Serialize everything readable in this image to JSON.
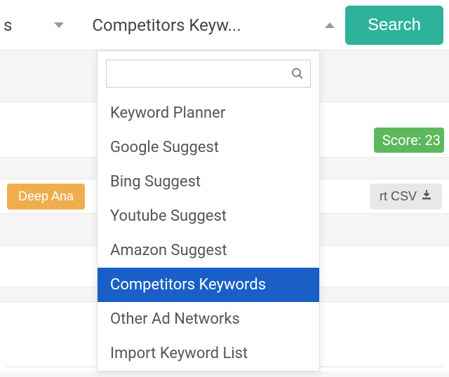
{
  "topbar": {
    "left_dropdown_partial": "s",
    "main_dropdown_display": "Competitors Keyw...",
    "search_button": "Search"
  },
  "dropdown": {
    "search_placeholder": "",
    "items": [
      "Keyword Planner",
      "Google Suggest",
      "Bing Suggest",
      "Youtube Suggest",
      "Amazon Suggest",
      "Competitors Keywords",
      "Other Ad Networks",
      "Import Keyword List"
    ],
    "selected_index": 5
  },
  "background": {
    "score_label": "Score: 23",
    "deep_button_partial": "Deep Ana",
    "export_button_partial": "rt CSV"
  }
}
